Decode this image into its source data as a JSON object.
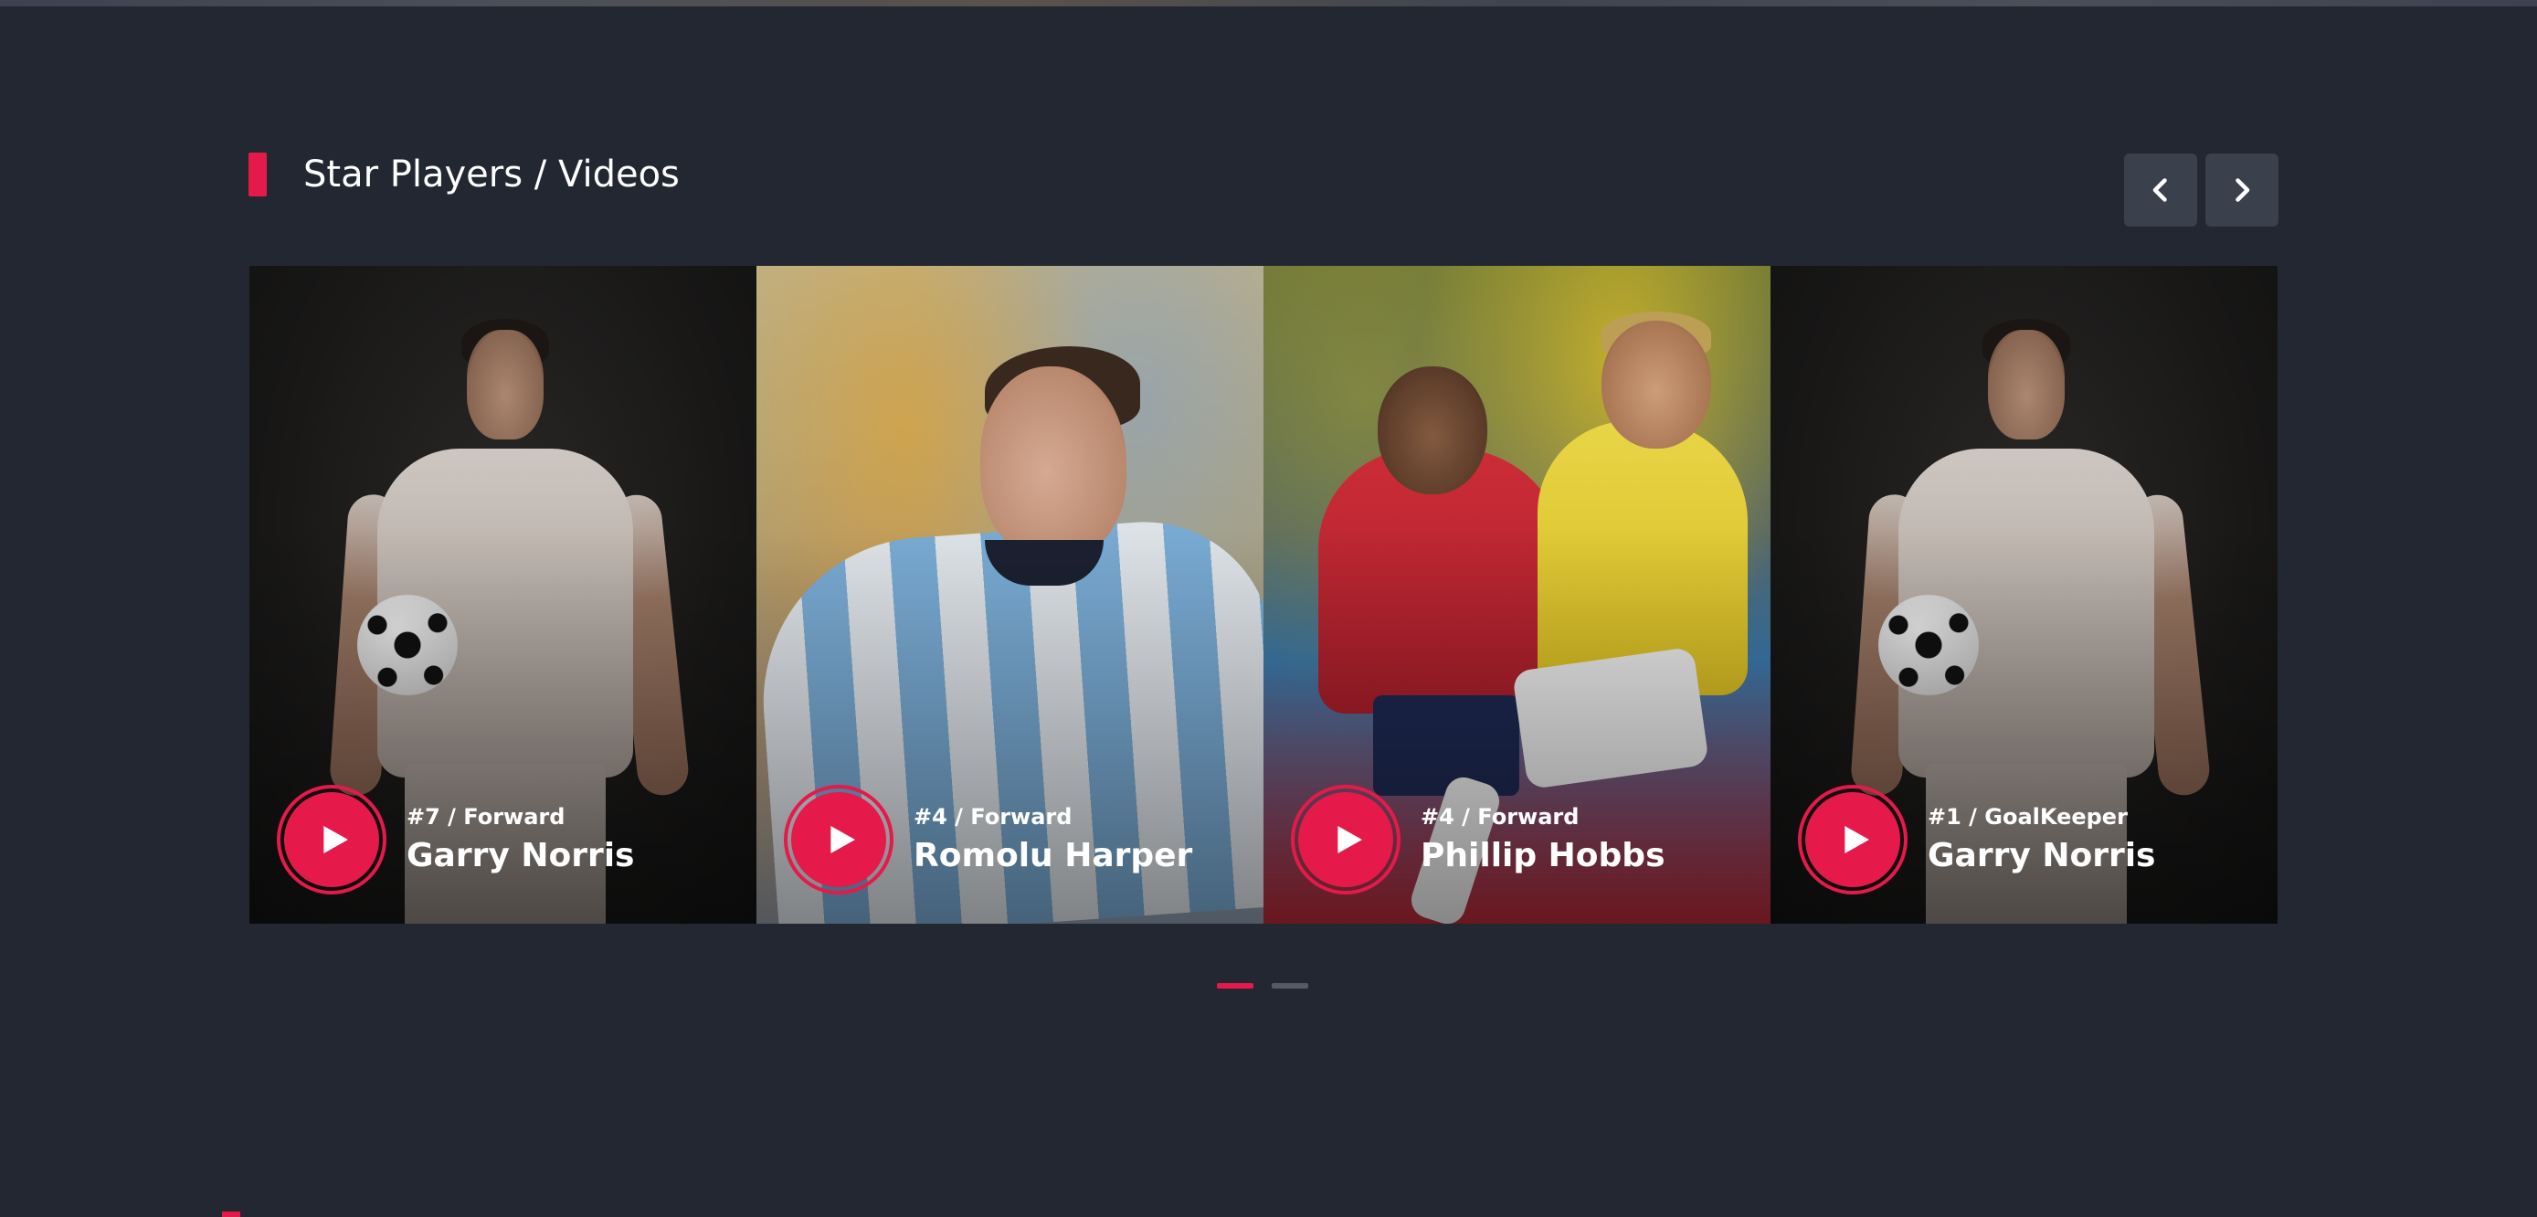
{
  "section": {
    "title": "Star Players / Videos"
  },
  "navigation": {
    "prev_icon": "chevron-left-icon",
    "next_icon": "chevron-right-icon"
  },
  "cards": [
    {
      "role": "#7 / Forward",
      "name": "Garry Norris"
    },
    {
      "role": "#4 / Forward",
      "name": "Romolu Harper"
    },
    {
      "role": "#4 / Forward",
      "name": "Phillip Hobbs"
    },
    {
      "role": "#1 / GoalKeeper",
      "name": "Garry Norris"
    }
  ],
  "pagination": {
    "active_index": 0,
    "count": 2
  },
  "colors": {
    "background": "#222731",
    "accent": "#e6194b",
    "button_bg": "#3a404c"
  }
}
